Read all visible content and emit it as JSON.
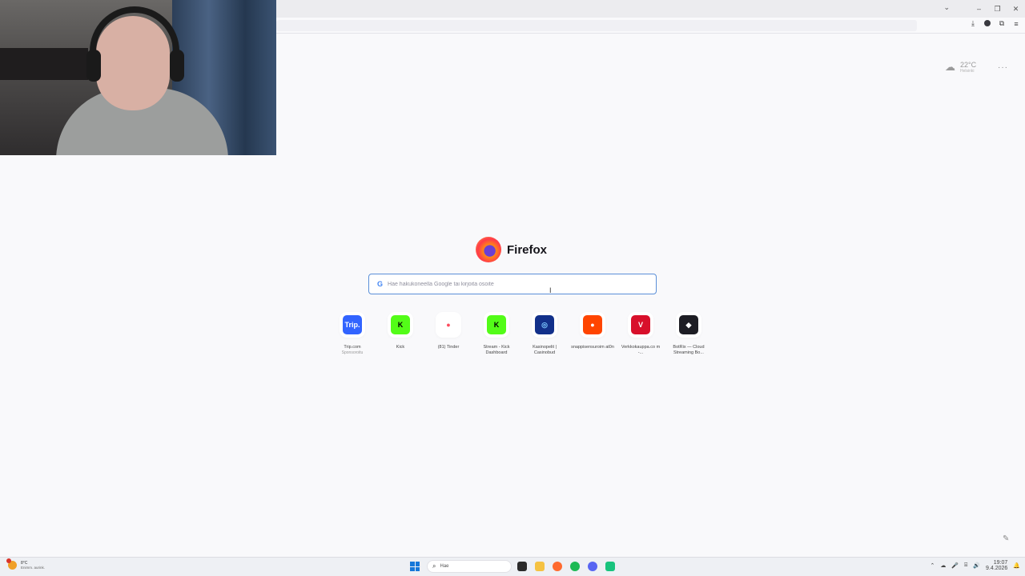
{
  "window": {
    "tab_list_icon": "chevron-down-icon",
    "minimize_icon": "minimize-icon",
    "restore_icon": "restore-icon",
    "close_icon": "close-icon",
    "minimize_glyph": "–",
    "restore_glyph": "❐",
    "close_glyph": "✕",
    "tab_list_glyph": "⌄"
  },
  "toolbar": {
    "download_glyph": "⤓",
    "extensions_glyph": "⧉",
    "menu_glyph": "≡"
  },
  "weather": {
    "temp": "22°C",
    "city": "Helsinki",
    "icon": "cloud-icon",
    "glyph": "☁"
  },
  "page_menu_glyph": "···",
  "brand": {
    "name": "Firefox"
  },
  "search": {
    "placeholder": "Hae hakukoneella Google tai kirjoita osoite",
    "engine_glyph": "G"
  },
  "shortcuts": [
    {
      "label": "Trip.com",
      "sub": "Sponsoroitu",
      "icon_text": "Trip.",
      "color": "#3264ff",
      "text_color": "#ffffff"
    },
    {
      "label": "Kick",
      "sub": "",
      "icon_text": "K",
      "color": "#53fc18",
      "text_color": "#000000"
    },
    {
      "label": "(81) Tinder",
      "sub": "",
      "icon_text": "●",
      "color": "#ffffff",
      "text_color": "#fd4c5e"
    },
    {
      "label": "Stream - Kick Dashboard",
      "sub": "",
      "icon_text": "K",
      "color": "#53fc18",
      "text_color": "#000000"
    },
    {
      "label": "Kasinopelit | Casinobud",
      "sub": "",
      "icon_text": "◎",
      "color": "#12308a",
      "text_color": "#7cc8ff"
    },
    {
      "label": "snappisensuroim at0n",
      "sub": "",
      "icon_text": "●",
      "color": "#ff4500",
      "text_color": "#ffffff"
    },
    {
      "label": "Verkkokauppa.co m -...",
      "sub": "",
      "icon_text": "V",
      "color": "#d8102b",
      "text_color": "#ffffff"
    },
    {
      "label": "BotRix — Cloud Streaming Bo...",
      "sub": "",
      "icon_text": "◆",
      "color": "#1d1d24",
      "text_color": "#ffffff"
    }
  ],
  "edit_glyph": "✎",
  "taskbar": {
    "weather_temp": "8°C",
    "weather_cond": "Enimm. aurink.",
    "search_text": "Hae",
    "search_glyph": "⌕",
    "apps": [
      {
        "name": "file-explorer-icon",
        "color": "#2b2b2b"
      },
      {
        "name": "folder-icon",
        "color": "#f5c242"
      },
      {
        "name": "firefox-icon",
        "color": "#ff6a2f"
      },
      {
        "name": "spotify-icon",
        "color": "#1db954"
      },
      {
        "name": "discord-icon",
        "color": "#5865f2"
      },
      {
        "name": "app-icon",
        "color": "#19c37d"
      }
    ],
    "tray_glyphs": [
      "⌃",
      "☁",
      "🎤",
      "⌸",
      "🔊"
    ],
    "time": "19:07",
    "date": "9.4.2026",
    "notif_glyph": "🔔"
  }
}
